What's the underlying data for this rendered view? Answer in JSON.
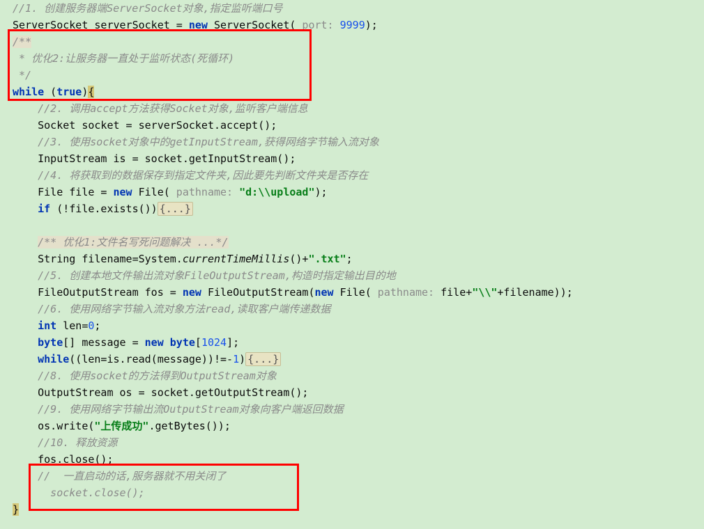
{
  "code": {
    "c1": "//1. 创建服务器端ServerSocket对象,指定监听端口号",
    "l2_a": "ServerSocket serverSocket = ",
    "l2_new": "new",
    "l2_b": " ServerSocket(",
    "l2_hint": " port: ",
    "l2_num": "9999",
    "l2_c": ");",
    "doc1": "/**",
    "doc2": " * 优化2:让服务器一直处于监听状态(死循环)",
    "doc3": " */",
    "while_kw": "while",
    "while_paren": " (",
    "true_kw": "true",
    "while_close": ")",
    "while_brace": "{",
    "c2": "//2. 调用accept方法获得Socket对象,监听客户端信息",
    "l_accept": "Socket socket = serverSocket.accept();",
    "c3": "//3. 使用socket对象中的getInputStream,获得网络字节输入流对象",
    "l_is": "InputStream is = socket.getInputStream();",
    "c4": "//4. 将获取到的数据保存到指定文件夹,因此要先判断文件夹是否存在",
    "l_file_a": "File file = ",
    "l_file_new": "new",
    "l_file_b": " File(",
    "l_file_hint": " pathname: ",
    "l_file_str": "\"d:\\\\upload\"",
    "l_file_c": ");",
    "if_kw": "if",
    "if_cond": " (!file.exists())",
    "fold1": "{...}",
    "doc_opt1": "/** 优化1:文件名写死问题解决 ...*/",
    "l_fn_a": "String filename=System.",
    "l_fn_m": "currentTimeMillis",
    "l_fn_b": "()+",
    "l_fn_str": "\".txt\"",
    "l_fn_c": ";",
    "c5": "//5. 创建本地文件输出流对象FileOutputStream,构造时指定输出目的地",
    "l_fos_a": "FileOutputStream fos = ",
    "l_fos_new1": "new",
    "l_fos_b": " FileOutputStream(",
    "l_fos_new2": "new",
    "l_fos_c": " File(",
    "l_fos_hint": " pathname: ",
    "l_fos_d": "file+",
    "l_fos_str": "\"\\\\\"",
    "l_fos_e": "+filename));",
    "c6": "//6. 使用网络字节输入流对象方法read,读取客户端传递数据",
    "int_kw": "int",
    "len_a": " len=",
    "len_zero": "0",
    "len_semi": ";",
    "byte_kw": "byte",
    "msg_a": "[] message = ",
    "msg_new": "new",
    "msg_b": " ",
    "byte_kw2": "byte",
    "msg_c": "[",
    "msg_num": "1024",
    "msg_d": "];",
    "while2_kw": "while",
    "while2_a": "((len=is.read(message))!=-",
    "while2_num": "1",
    "while2_b": ")",
    "fold2": "{...}",
    "c8": "//8. 使用socket的方法得到OutputStream对象",
    "l_os": "OutputStream os = socket.getOutputStream();",
    "c9": "//9. 使用网络字节输出流OutputStream对象向客户端返回数据",
    "l_write_a": "os.write(",
    "l_write_str": "\"上传成功\"",
    "l_write_b": ".getBytes());",
    "c10": "//10. 释放资源",
    "l_fosclose": "fos.close();",
    "c_last": "//  一直启动的话,服务器就不用关闭了",
    "l_sclose": "  socket.close();",
    "brace_end": "}"
  }
}
